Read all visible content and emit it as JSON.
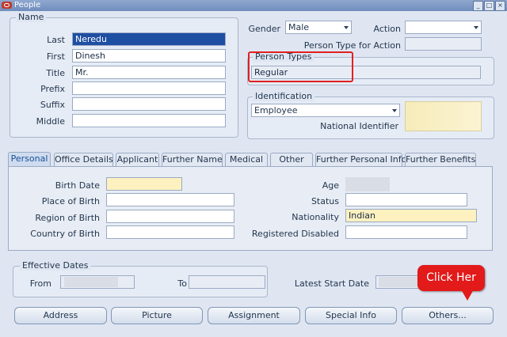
{
  "window": {
    "title": "People"
  },
  "name_group": {
    "label": "Name",
    "last_label": "Last",
    "last_value": "Neredu",
    "first_label": "First",
    "first_value": "Dinesh",
    "title_label": "Title",
    "title_value": "Mr.",
    "prefix_label": "Prefix",
    "prefix_value": "",
    "suffix_label": "Suffix",
    "suffix_value": "",
    "middle_label": "Middle",
    "middle_value": ""
  },
  "gender": {
    "label": "Gender",
    "value": "Male"
  },
  "action": {
    "label": "Action",
    "value": ""
  },
  "person_type_for_action": {
    "label": "Person Type for Action",
    "value": ""
  },
  "person_types": {
    "label": "Person Types",
    "value": "Regular"
  },
  "identification": {
    "label": "Identification",
    "value": "Employee",
    "national_identifier_label": "National Identifier"
  },
  "tabs": [
    {
      "label": "Personal",
      "active": true
    },
    {
      "label": "Office Details"
    },
    {
      "label": "Applicant"
    },
    {
      "label": "Further Name"
    },
    {
      "label": "Medical"
    },
    {
      "label": "Other"
    },
    {
      "label": "Further Personal Info"
    },
    {
      "label": "Further Benefits"
    }
  ],
  "personal": {
    "birth_date_label": "Birth Date",
    "place_of_birth_label": "Place of Birth",
    "region_of_birth_label": "Region of Birth",
    "country_of_birth_label": "Country of Birth",
    "age_label": "Age",
    "status_label": "Status",
    "nationality_label": "Nationality",
    "nationality_value": "Indian",
    "registered_disabled_label": "Registered Disabled"
  },
  "effective_dates": {
    "label": "Effective Dates",
    "from_label": "From",
    "to_label": "To"
  },
  "latest_start_date": {
    "label": "Latest Start Date"
  },
  "buttons": {
    "address": "Address",
    "picture": "Picture",
    "assignment": "Assignment",
    "special_info": "Special Info",
    "others": "Others..."
  },
  "callout": {
    "text": "Click Her"
  },
  "colors": {
    "accent": "#1f4fa3",
    "required_field": "#fcf1bf",
    "callout": "#e21a1a",
    "background": "#dfe6f2"
  }
}
